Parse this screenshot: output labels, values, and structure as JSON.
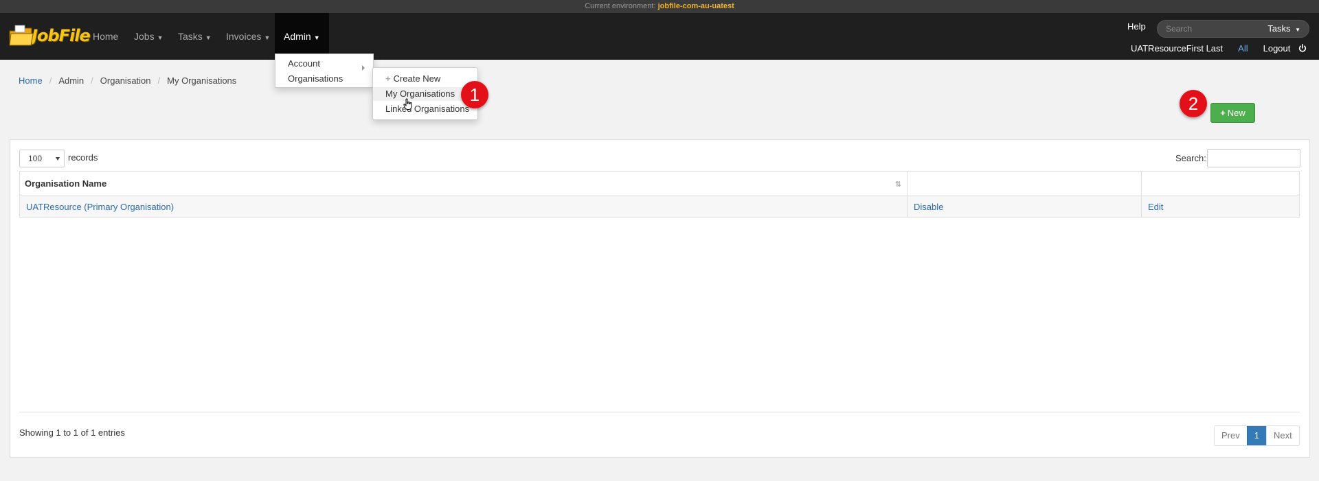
{
  "env": {
    "label": "Current environment:",
    "value": "jobfile-com-au-uatest"
  },
  "brand": {
    "name": "JobFile"
  },
  "nav": {
    "items": [
      {
        "label": "Home"
      },
      {
        "label": "Jobs"
      },
      {
        "label": "Tasks"
      },
      {
        "label": "Invoices"
      },
      {
        "label": "Admin"
      }
    ]
  },
  "header_right": {
    "help": "Help",
    "search_placeholder": "Search",
    "search_scope": "Tasks",
    "user": "UATResourceFirst Last",
    "all": "All",
    "logout": "Logout"
  },
  "breadcrumb": [
    "Home",
    "Admin",
    "Organisation",
    "My Organisations"
  ],
  "admin_menu": {
    "items": [
      "Account",
      "Organisations"
    ]
  },
  "org_submenu": {
    "items": [
      "Create New",
      "My Organisations",
      "Linked Organisations"
    ]
  },
  "callouts": [
    "1",
    "2"
  ],
  "new_button": "New",
  "table_controls": {
    "records_value": "100",
    "records_label": "records",
    "search_label": "Search:"
  },
  "table": {
    "columns": [
      "Organisation Name",
      "",
      ""
    ],
    "rows": [
      {
        "name": "UATResource (Primary Organisation)",
        "action1": "Disable",
        "action2": "Edit"
      }
    ]
  },
  "footer": {
    "showing": "Showing 1 to 1 of 1 entries",
    "prev": "Prev",
    "page": "1",
    "next": "Next"
  },
  "colors": {
    "accent_green": "#4cae4c",
    "callout_red": "#e3101a",
    "link": "#2a6ab0",
    "brand_yellow": "#f5c518"
  },
  "icons": [
    "jobfile-logo-icon",
    "caret-down-icon",
    "power-icon",
    "plus-icon",
    "sort-icon",
    "hand-cursor-icon",
    "submenu-arrow-icon"
  ]
}
